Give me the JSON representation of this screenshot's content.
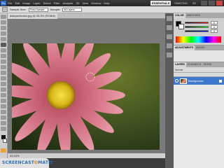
{
  "app": {
    "logo": "Ps"
  },
  "menu": [
    "File",
    "Edit",
    "Image",
    "Layer",
    "Select",
    "Filter",
    "Analysis",
    "3D",
    "View",
    "Window",
    "Help"
  ],
  "workspaces": [
    {
      "label": "ESSENTIALS",
      "active": true
    },
    {
      "label": "PAINTING",
      "active": false
    },
    {
      "label": "3D",
      "active": false
    }
  ],
  "options": {
    "sample_size_label": "Sample Size:",
    "sample_size_value": "Point Sample",
    "sample_label": "Sample:",
    "sample_value": "All Layers"
  },
  "document": {
    "tab": "daisyselection.jpg @ 33.3% (RGB/8)",
    "status": "33.33%"
  },
  "panels": {
    "color_tabs": [
      "Color",
      "Swatches"
    ],
    "rgb": {
      "r": "0",
      "g": "0",
      "b": "0"
    },
    "adjust_tabs": [
      "Adjustments",
      "Masks"
    ],
    "layers_tabs": [
      "Layers",
      "Channels",
      "Paths"
    ],
    "layers_options": "Normal",
    "layer_name": "Background"
  },
  "watermark": {
    "pre": "SCREENCAST",
    "o": "O",
    "post": "MATIC"
  },
  "icons": {
    "logo": "photoshop-logo",
    "eye": "eye-icon",
    "lock": "lock-icon",
    "eyedropper": "eyedropper-icon"
  },
  "colors": {
    "layer_highlight": "#3d78cc",
    "petal": "#d4627a",
    "center": "#e8c820",
    "background": "#3a4a1e"
  }
}
